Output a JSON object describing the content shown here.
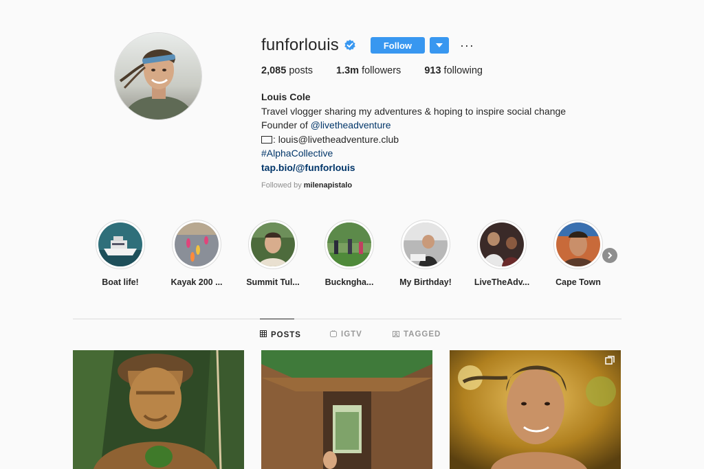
{
  "profile": {
    "username": "funforlouis",
    "follow_label": "Follow",
    "more_label": "···",
    "stats": {
      "posts_count": "2,085",
      "posts_label": "posts",
      "followers_count": "1.3m",
      "followers_label": "followers",
      "following_count": "913",
      "following_label": "following"
    },
    "bio": {
      "name": "Louis Cole",
      "line1": "Travel vlogger sharing my adventures & hoping to inspire social change",
      "line2_prefix": "Founder of ",
      "line2_link": "@livetheadventure",
      "line3": ": louis@livetheadventure.club",
      "line4": "#AlphaCollective",
      "line5": "tap.bio/@funforlouis"
    },
    "followed_by_prefix": "Followed by",
    "followed_by_user": "milenapistalo"
  },
  "highlights": [
    {
      "label": "Boat life!"
    },
    {
      "label": "Kayak 200 ..."
    },
    {
      "label": "Summit Tul..."
    },
    {
      "label": "Buckngha..."
    },
    {
      "label": "My Birthday!"
    },
    {
      "label": "LiveTheAdv..."
    },
    {
      "label": "Cape Town"
    }
  ],
  "tabs": [
    {
      "label": "POSTS",
      "icon": "grid-icon",
      "active": true
    },
    {
      "label": "IGTV",
      "icon": "igtv-icon",
      "active": false
    },
    {
      "label": "TAGGED",
      "icon": "tagged-icon",
      "active": false
    }
  ],
  "colors": {
    "accent": "#3897f0",
    "link": "#003569",
    "background": "#fafafa",
    "muted": "#8e8e8e"
  }
}
